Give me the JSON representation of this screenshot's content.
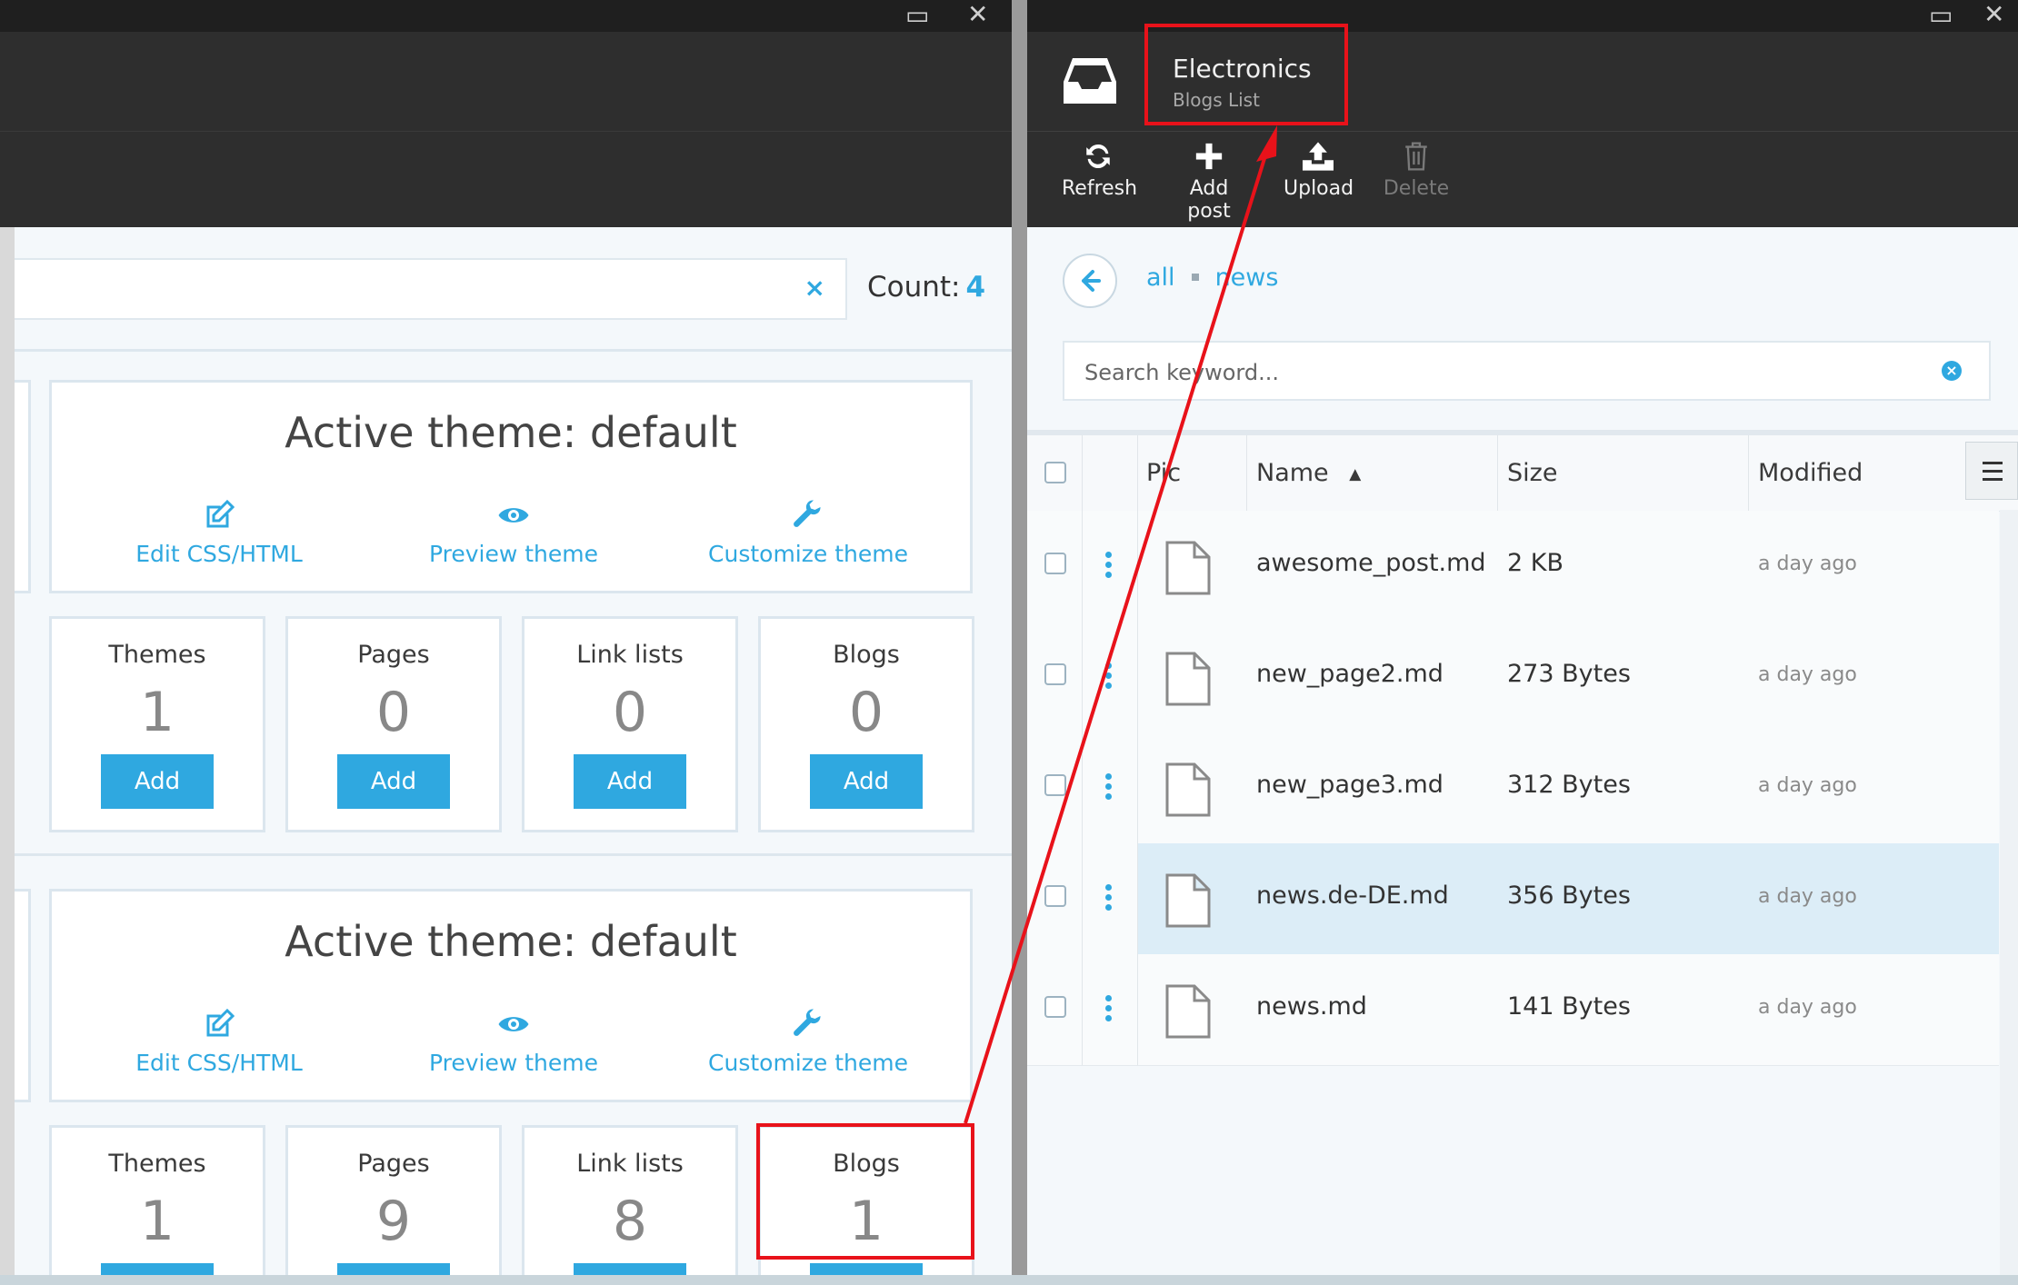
{
  "left": {
    "count_label": "Count:",
    "count_value": "4",
    "search_clear": "×",
    "theme_cards": [
      {
        "title": "Active theme: default",
        "actions": {
          "edit": "Edit CSS/HTML",
          "preview": "Preview theme",
          "customize": "Customize theme"
        },
        "stats": [
          {
            "label": "Themes",
            "value": "1",
            "button": "Add"
          },
          {
            "label": "Pages",
            "value": "0",
            "button": "Add"
          },
          {
            "label": "Link lists",
            "value": "0",
            "button": "Add"
          },
          {
            "label": "Blogs",
            "value": "0",
            "button": "Add"
          }
        ]
      },
      {
        "title": "Active theme: default",
        "actions": {
          "edit": "Edit CSS/HTML",
          "preview": "Preview theme",
          "customize": "Customize theme"
        },
        "stats": [
          {
            "label": "Themes",
            "value": "1"
          },
          {
            "label": "Pages",
            "value": "9"
          },
          {
            "label": "Link lists",
            "value": "8"
          },
          {
            "label": "Blogs",
            "value": "1"
          }
        ]
      }
    ]
  },
  "right": {
    "title": "Electronics",
    "subtitle": "Blogs List",
    "toolbar": {
      "refresh": "Refresh",
      "add_post": "Add post",
      "upload": "Upload",
      "delete": "Delete"
    },
    "breadcrumb": [
      "all",
      "news"
    ],
    "search": {
      "placeholder": "Search keyword...",
      "value": ""
    },
    "grid": {
      "columns": {
        "pic": "Pic",
        "name": "Name",
        "size": "Size",
        "modified": "Modified"
      },
      "sort": {
        "column": "Name",
        "direction": "ascending"
      },
      "rows": [
        {
          "name": "awesome_post.md",
          "size": "2 KB",
          "modified": "a day ago",
          "selected": false
        },
        {
          "name": "new_page2.md",
          "size": "273 Bytes",
          "modified": "a day ago",
          "selected": false
        },
        {
          "name": "new_page3.md",
          "size": "312 Bytes",
          "modified": "a day ago",
          "selected": false
        },
        {
          "name": "news.de-DE.md",
          "size": "356 Bytes",
          "modified": "a day ago",
          "selected": true
        },
        {
          "name": "news.md",
          "size": "141 Bytes",
          "modified": "a day ago",
          "selected": false
        }
      ]
    }
  },
  "colors": {
    "accent": "#2fa8e0",
    "header_bg": "#2e2e2e",
    "annotation_red": "#e8121a",
    "selected_row": "#dcedf7"
  },
  "icons": {
    "app": "inbox-tray-icon",
    "refresh": "refresh-icon",
    "add_post": "plus-icon",
    "upload": "upload-icon",
    "delete": "trash-icon",
    "back": "arrow-left-circle-icon",
    "file": "file-icon",
    "row_menu": "kebab-icon",
    "column_menu": "hamburger-icon",
    "edit": "edit-icon",
    "preview": "eye-icon",
    "customize": "wrench-icon",
    "window_maximize": "maximize-icon",
    "window_close": "close-icon"
  }
}
